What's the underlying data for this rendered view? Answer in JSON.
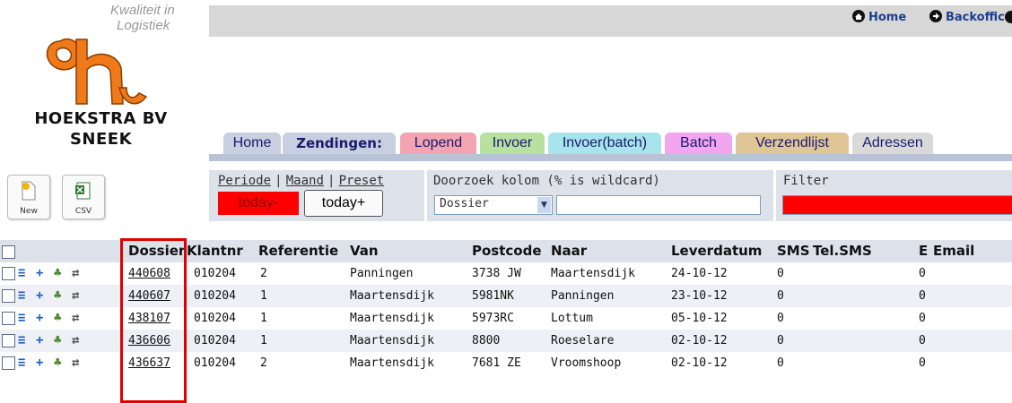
{
  "logo": {
    "tagline_1": "Kwaliteit in",
    "tagline_2": "Logistiek",
    "company_line_1": "HOEKSTRA BV",
    "company_line_2": "SNEEK",
    "orange": "#f07a1a"
  },
  "top_links": [
    {
      "label": "Home",
      "icon": "home-icon"
    },
    {
      "label": "Backoffice",
      "icon": "arrow-right-circle-icon"
    }
  ],
  "tabs": [
    {
      "label": "Home",
      "color": "#c7cfe0",
      "active": false
    },
    {
      "label": "Zendingen:",
      "color": "#c7cfe0",
      "active": true
    },
    {
      "label": "Lopend",
      "color": "#f2a5b0",
      "active": false
    },
    {
      "label": "Invoer",
      "color": "#b8e0a0",
      "active": false
    },
    {
      "label": "Invoer(batch)",
      "color": "#a8e4ec",
      "active": false
    },
    {
      "label": "Batch",
      "color": "#f3a6f0",
      "active": false
    },
    {
      "label": "Verzendlijst",
      "color": "#e0c596",
      "active": false
    },
    {
      "label": "Adressen",
      "color": "#d9d9d9",
      "active": false
    }
  ],
  "toolbar": {
    "new_label": "New",
    "csv_label": "CSV"
  },
  "period": {
    "links": [
      "Periode",
      "Maand",
      "Preset"
    ],
    "separator": "|",
    "today_minus": "today-",
    "today_plus": "today+"
  },
  "search": {
    "label": "Doorzoek kolom (% is wildcard)",
    "column_value": "Dossier",
    "query_value": ""
  },
  "filter": {
    "label": "Filter",
    "color": "#ff0000"
  },
  "table": {
    "headers": [
      "Dossier",
      "Klantnr",
      "Referentie",
      "Van",
      "Postcode",
      "Naar",
      "Leverdatum",
      "SMS",
      "Tel.SMS",
      "E",
      "Email"
    ],
    "rows": [
      {
        "dossier": "440608",
        "klantnr": "010204",
        "referentie": "2",
        "van": "Panningen",
        "postcode": "3738 JW",
        "naar": "Maartensdijk",
        "leverdatum": "24-10-12",
        "sms": "0",
        "telsms": "",
        "e": "0",
        "email": ""
      },
      {
        "dossier": "440607",
        "klantnr": "010204",
        "referentie": "1",
        "van": "Maartensdijk",
        "postcode": "5981NK",
        "naar": "Panningen",
        "leverdatum": "23-10-12",
        "sms": "0",
        "telsms": "",
        "e": "0",
        "email": ""
      },
      {
        "dossier": "438107",
        "klantnr": "010204",
        "referentie": "1",
        "van": "Maartensdijk",
        "postcode": "5973RC",
        "naar": "Lottum",
        "leverdatum": "05-10-12",
        "sms": "0",
        "telsms": "",
        "e": "0",
        "email": ""
      },
      {
        "dossier": "436606",
        "klantnr": "010204",
        "referentie": "1",
        "van": "Maartensdijk",
        "postcode": "8800",
        "naar": "Roeselare",
        "leverdatum": "02-10-12",
        "sms": "0",
        "telsms": "",
        "e": "0",
        "email": ""
      },
      {
        "dossier": "436637",
        "klantnr": "010204",
        "referentie": "2",
        "van": "Maartensdijk",
        "postcode": "7681 ZE",
        "naar": "Vroomshoop",
        "leverdatum": "02-10-12",
        "sms": "0",
        "telsms": "",
        "e": "0",
        "email": ""
      }
    ]
  },
  "row_icons": [
    "list-icon",
    "plus-circle-icon",
    "plant-icon",
    "swap-arrows-icon"
  ],
  "colors": {
    "highlight_box": "#e00000",
    "header_bg": "#dde1e9",
    "row_even": "#ffffff",
    "row_odd": "#eef0f5",
    "icon_blue": "#1a5fc4",
    "icon_green": "#4b8a2a"
  }
}
